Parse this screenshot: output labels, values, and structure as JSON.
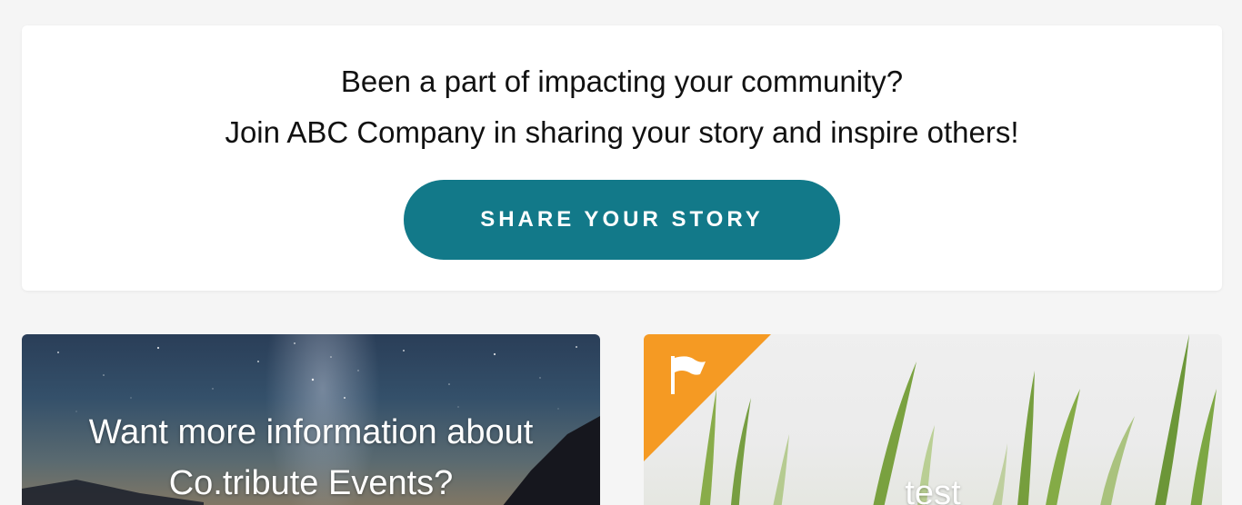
{
  "cta": {
    "line1": "Been a part of impacting your community?",
    "line2": "Join ABC Company in sharing your story and inspire others!",
    "button_label": "SHARE YOUR STORY"
  },
  "tiles": [
    {
      "title_line1": "Want more information about",
      "title_line2": "Co.tribute Events?"
    },
    {
      "title": "test",
      "badge_icon": "flag-icon"
    }
  ],
  "colors": {
    "page_background": "#f5f5f5",
    "card_background": "#ffffff",
    "button_background": "#127989",
    "button_text": "#ffffff",
    "badge_orange": "#f59a23"
  }
}
